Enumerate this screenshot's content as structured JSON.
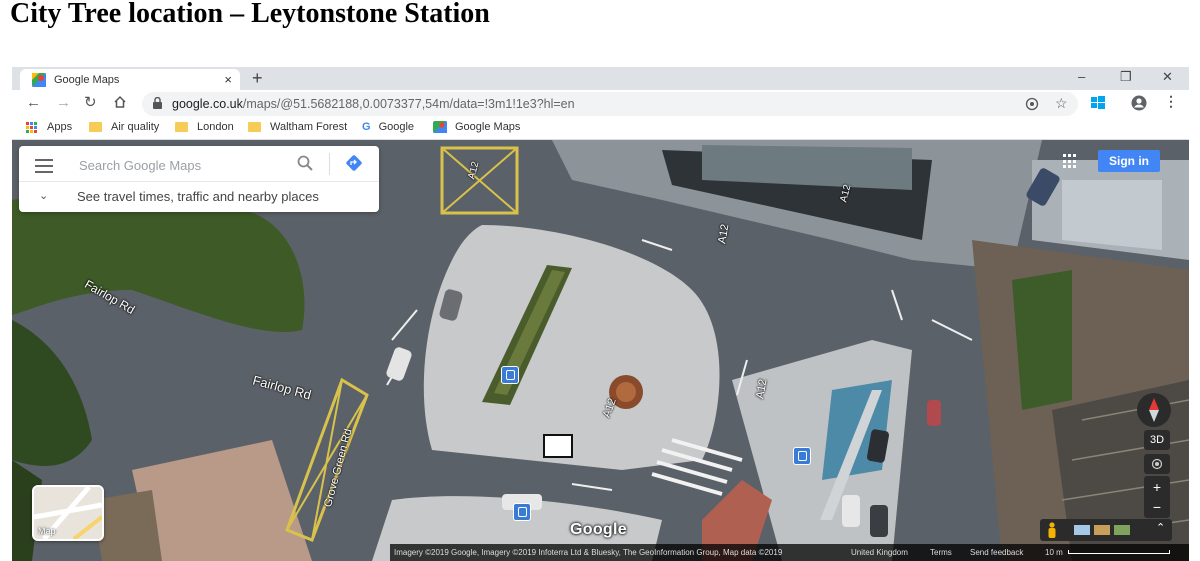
{
  "document": {
    "title": "City Tree location – Leytonstone Station"
  },
  "browser": {
    "tab_title": "Google Maps",
    "tab_close": "×",
    "new_tab": "+",
    "window_controls": [
      "–",
      "❒",
      "✕"
    ],
    "url_host": "google.co.uk",
    "url_path": "/maps/@51.5682188,0.0073377,54m/data=!3m1!1e3?hl=en",
    "bookmarks": [
      {
        "label": "Apps",
        "icon": "apps-grid-icon"
      },
      {
        "label": "Air quality",
        "icon": "folder-icon"
      },
      {
        "label": "London",
        "icon": "folder-icon"
      },
      {
        "label": "Waltham Forest",
        "icon": "folder-icon"
      },
      {
        "label": "Google",
        "icon": "google-g-icon"
      },
      {
        "label": "Google Maps",
        "icon": "maps-icon"
      }
    ]
  },
  "maps": {
    "search_placeholder": "Search Google Maps",
    "explore_hint": "See travel times, traffic and nearby places",
    "sign_in": "Sign in",
    "layer_label": "Map",
    "three_d": "3D",
    "zoom_in": "+",
    "zoom_out": "−",
    "logo": "Google",
    "street_labels": [
      "Fairlop Rd",
      "Fairlop Rd",
      "A12",
      "A12",
      "A12",
      "A12",
      "A12",
      "Grove Green Rd"
    ],
    "footer": {
      "imagery": "Imagery ©2019 Google, Imagery ©2019 Infoterra Ltd & Bluesky, The GeoInformation Group, Map data ©2019",
      "region": "United Kingdom",
      "terms": "Terms",
      "feedback": "Send feedback",
      "scale": "10 m"
    }
  },
  "colors": {
    "accent": "#4285f4",
    "tabstrip": "#dee1e6",
    "road": "#5a6068",
    "plaza": "#c9cbcc",
    "greenery": "#3f5a2a"
  }
}
